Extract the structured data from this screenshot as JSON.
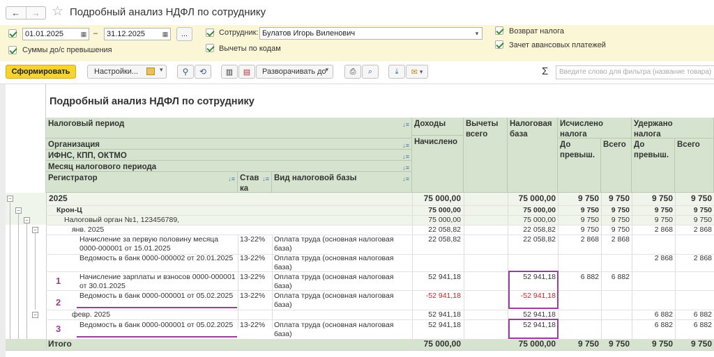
{
  "window": {
    "title": "Подробный анализ НДФЛ по сотруднику",
    "back": "←",
    "forward": "→",
    "favorite": "☆"
  },
  "settings": {
    "date_from": "01.01.2025",
    "date_dash": "–",
    "date_to": "31.12.2025",
    "dots_label": "...",
    "employee_label": "Сотрудник:",
    "employee_value": "Булатов Игорь Виленович",
    "deductions_by_codes": "Вычеты по кодам",
    "sum_before_exceed": "Суммы до/с превышения",
    "tax_refund": "Возврат налога",
    "advance_offset": "Зачет авансовых платежей"
  },
  "toolbar": {
    "generate": "Сформировать",
    "settings": "Настройки...",
    "expand": "Разворачивать до",
    "sigma": "Σ",
    "filter_placeholder": "Введите слово для фильтра (название товара)"
  },
  "report": {
    "title": "Подробный анализ НДФЛ по сотруднику",
    "headers": {
      "tax_period": "Налоговый период",
      "organization": "Организация",
      "ifns": "ИФНС, КПП, ОКТМО",
      "month": "Месяц налогового периода",
      "registrar": "Регистратор",
      "rate": "Ставка",
      "base_kind": "Вид налоговой базы",
      "income": "Доходы",
      "accrued": "Начислено",
      "deductions": "Вычеты всего",
      "tax_base": "Налоговая база",
      "calculated": "Исчислено налога",
      "withheld": "Удержано налога",
      "before_exceed": "До превыш.",
      "total": "Всего"
    },
    "rows": [
      {
        "label": "2025",
        "income": "75 000,00",
        "ded": "",
        "base": "75 000,00",
        "c1": "9 750",
        "c2": "9 750",
        "w1": "9 750",
        "w2": "9 750"
      },
      {
        "label": "Крон-Ц",
        "income": "75 000,00",
        "ded": "",
        "base": "75 000,00",
        "c1": "9 750",
        "c2": "9 750",
        "w1": "9 750",
        "w2": "9 750"
      },
      {
        "label": "Налоговый орган №1, 123456789,",
        "income": "75 000,00",
        "ded": "",
        "base": "75 000,00",
        "c1": "9 750",
        "c2": "9 750",
        "w1": "9 750",
        "w2": "9 750"
      },
      {
        "label": "янв. 2025",
        "income": "22 058,82",
        "ded": "",
        "base": "22 058,82",
        "c1": "9 750",
        "c2": "9 750",
        "w1": "2 868",
        "w2": "2 868"
      },
      {
        "label": "Начисление за первую половину месяца 0000-000001 от 15.01.2025",
        "rate": "13-22%",
        "kind": "Оплата труда (основная налоговая база)",
        "income": "22 058,82",
        "ded": "",
        "base": "22 058,82",
        "c1": "2 868",
        "c2": "2 868",
        "w1": "",
        "w2": ""
      },
      {
        "label": "Ведомость в банк 0000-000002 от 20.01.2025",
        "rate": "13-22%",
        "kind": "Оплата труда (основная налоговая база)",
        "income": "",
        "ded": "",
        "base": "",
        "c1": "",
        "c2": "",
        "w1": "2 868",
        "w2": "2 868"
      },
      {
        "label": "Начисление зарплаты и взносов 0000-000001 от 30.01.2025",
        "rate": "13-22%",
        "kind": "Оплата труда (основная налоговая база)",
        "income": "52 941,18",
        "ded": "",
        "base": "52 941,18",
        "c1": "6 882",
        "c2": "6 882",
        "w1": "",
        "w2": ""
      },
      {
        "label": "Ведомость в банк 0000-000001 от 05.02.2025",
        "rate": "13-22%",
        "kind": "Оплата труда (основная налоговая база)",
        "income": "-52 941,18",
        "ded": "",
        "base": "-52 941,18",
        "c1": "",
        "c2": "",
        "w1": "",
        "w2": ""
      },
      {
        "label": "февр. 2025",
        "income": "52 941,18",
        "ded": "",
        "base": "52 941,18",
        "c1": "",
        "c2": "",
        "w1": "6 882",
        "w2": "6 882"
      },
      {
        "label": "Ведомость в банк 0000-000001 от 05.02.2025",
        "rate": "13-22%",
        "kind": "Оплата труда (основная налоговая база)",
        "income": "52 941,18",
        "ded": "",
        "base": "52 941,18",
        "c1": "",
        "c2": "",
        "w1": "6 882",
        "w2": "6 882"
      }
    ],
    "total": {
      "label": "Итого",
      "income": "75 000,00",
      "base": "75 000,00",
      "c1": "9 750",
      "c2": "9 750",
      "w1": "9 750",
      "w2": "9 750"
    },
    "markers": [
      "1",
      "2",
      "3"
    ]
  },
  "colors": {
    "accent_yellow": "#f7d330",
    "header_green": "#d6e4cf",
    "annotation_purple": "#9b3d9a",
    "negative_red": "#d2202a"
  }
}
